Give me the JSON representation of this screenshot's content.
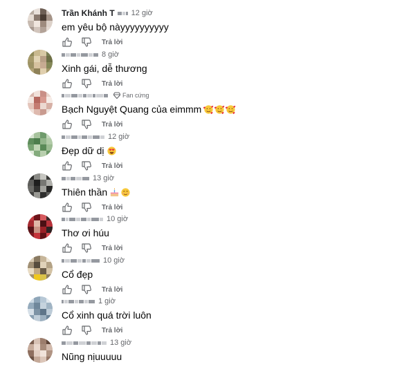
{
  "reply_label": "Trả lời",
  "fan_badge_label": "Fan cứng",
  "comments": [
    {
      "author": "Trần Khánh T",
      "time": "12 giờ",
      "text": "em yêu bộ nàyyyyyyyyyy"
    },
    {
      "author": "",
      "time": "8 giờ",
      "text": "Xinh gái, dễ thương"
    },
    {
      "author": "",
      "time": "",
      "text": "Bạch Nguyệt Quang của eimmm"
    },
    {
      "author": "",
      "time": "12 giờ",
      "text": "Đẹp dữ dị"
    },
    {
      "author": "",
      "time": "13 giờ",
      "text": "Thiên thần"
    },
    {
      "author": "",
      "time": "10 giờ",
      "text": "Thơ ơi húu"
    },
    {
      "author": "",
      "time": "10 giờ",
      "text": "Cổ đẹp"
    },
    {
      "author": "",
      "time": "1 giờ",
      "text": "Cổ xinh quá trời luôn"
    },
    {
      "author": "",
      "time": "13 giờ",
      "text": "Nũng nịuuuuu"
    }
  ],
  "colors": {
    "text": "#050505",
    "meta": "#65676b",
    "background": "#ffffff"
  },
  "icons": {
    "like": "thumbs-up-icon",
    "dislike": "thumbs-down-icon",
    "fan": "diamond-badge-icon",
    "heart_face": "smiling-face-with-hearts-icon",
    "heart_eyes": "heart-eyes-icon",
    "cake": "birthday-cake-icon",
    "smile": "blush-smile-icon"
  }
}
